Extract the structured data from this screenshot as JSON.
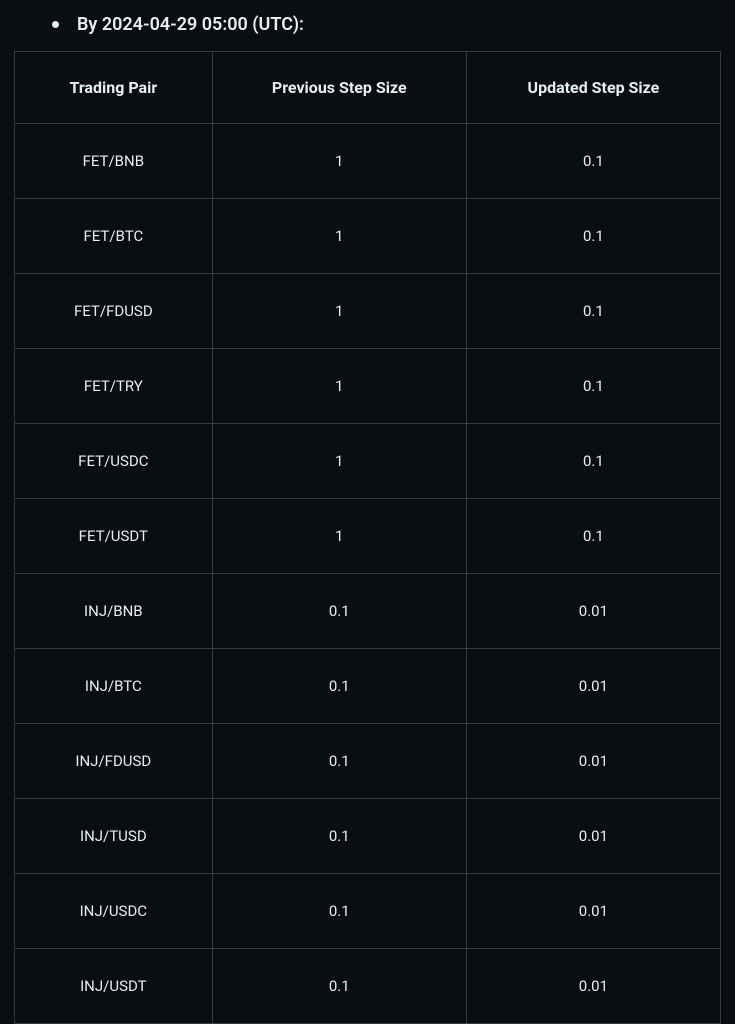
{
  "bullet": {
    "text": "By 2024-04-29 05:00 (UTC):"
  },
  "table": {
    "headers": {
      "pair": "Trading Pair",
      "previous": "Previous Step Size",
      "updated": "Updated Step Size"
    },
    "rows": [
      {
        "pair": "FET/BNB",
        "previous": "1",
        "updated": "0.1"
      },
      {
        "pair": "FET/BTC",
        "previous": "1",
        "updated": "0.1"
      },
      {
        "pair": "FET/FDUSD",
        "previous": "1",
        "updated": "0.1"
      },
      {
        "pair": "FET/TRY",
        "previous": "1",
        "updated": "0.1"
      },
      {
        "pair": "FET/USDC",
        "previous": "1",
        "updated": "0.1"
      },
      {
        "pair": "FET/USDT",
        "previous": "1",
        "updated": "0.1"
      },
      {
        "pair": "INJ/BNB",
        "previous": "0.1",
        "updated": "0.01"
      },
      {
        "pair": "INJ/BTC",
        "previous": "0.1",
        "updated": "0.01"
      },
      {
        "pair": "INJ/FDUSD",
        "previous": "0.1",
        "updated": "0.01"
      },
      {
        "pair": "INJ/TUSD",
        "previous": "0.1",
        "updated": "0.01"
      },
      {
        "pair": "INJ/USDC",
        "previous": "0.1",
        "updated": "0.01"
      },
      {
        "pair": "INJ/USDT",
        "previous": "0.1",
        "updated": "0.01"
      }
    ]
  }
}
